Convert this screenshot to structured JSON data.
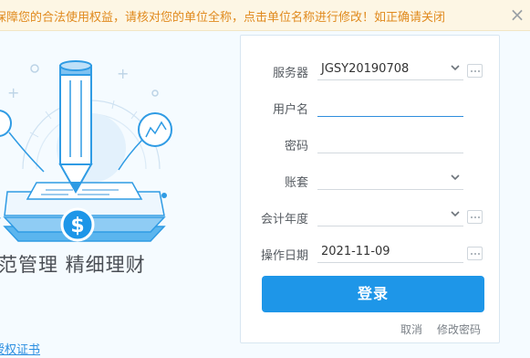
{
  "notice": {
    "text": "保障您的合法使用权益，请核对您的单位全称，点击单位名称进行修改！如正确请关闭",
    "close_symbol": "×"
  },
  "branding": {
    "slogan": "范管理  精细理财",
    "license_link": "授权证书"
  },
  "login_form": {
    "server_label": "服务器",
    "server_value": "JGSY20190708",
    "username_label": "用户名",
    "username_value": "",
    "password_label": "密码",
    "password_value": "",
    "account_set_label": "账套",
    "account_set_value": "",
    "fiscal_year_label": "会计年度",
    "fiscal_year_value": "",
    "operation_date_label": "操作日期",
    "operation_date_value": "2021-11-09",
    "login_button": "登录",
    "cancel_link": "取消",
    "change_password_link": "修改密码"
  },
  "colors": {
    "accent": "#1e96e8",
    "notice_text": "#e08a1e",
    "notice_background": "#fdf6e4"
  },
  "icons": {
    "illustration": "pencil-document-dollar-illustration",
    "dropdown": "chevron-down-icon",
    "more": "ellipsis-icon",
    "close": "close-icon"
  }
}
